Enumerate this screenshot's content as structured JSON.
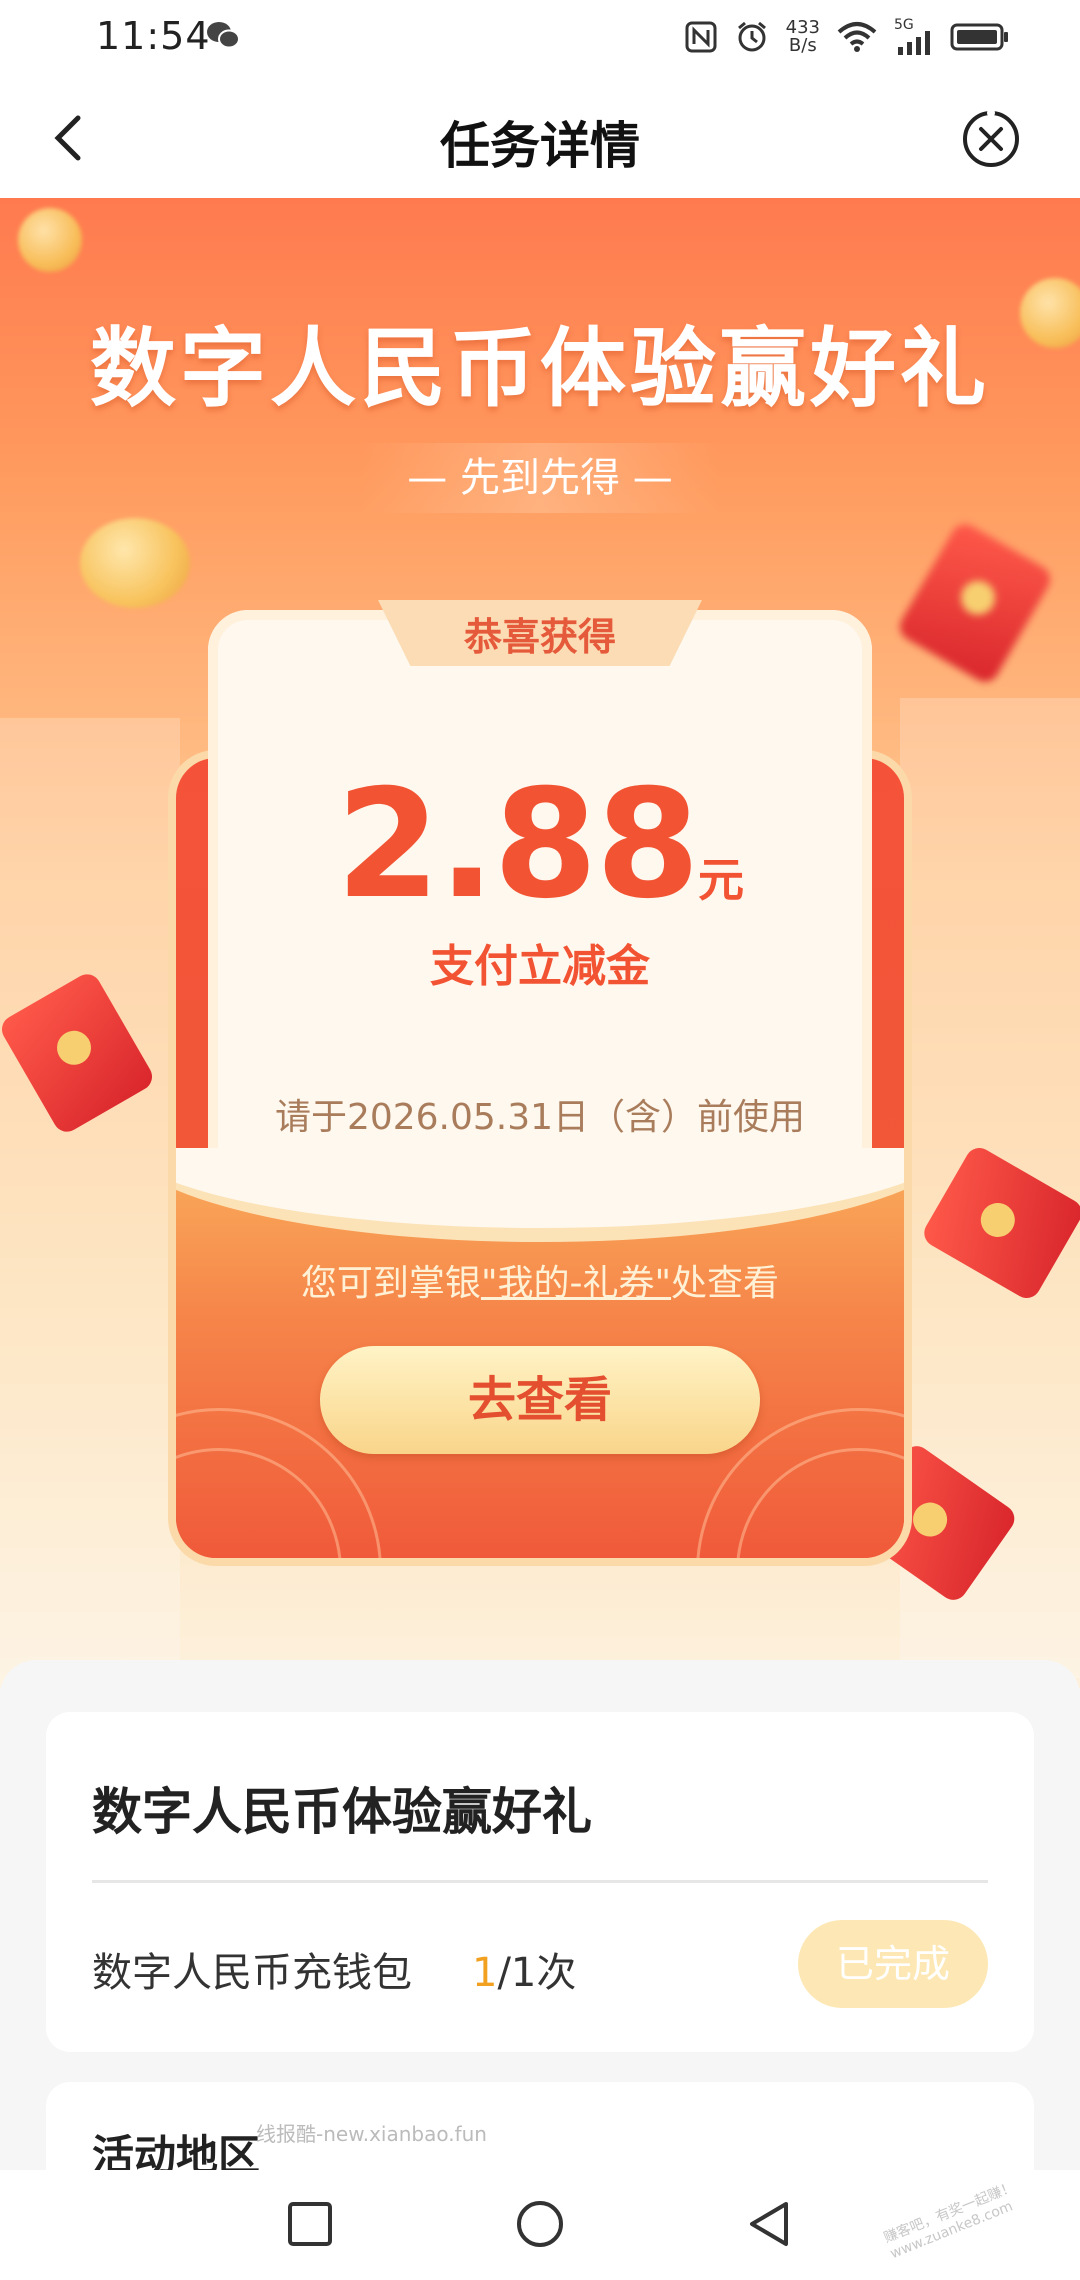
{
  "status_bar": {
    "time": "11:54",
    "net_speed_value": "433",
    "net_speed_unit": "B/s",
    "network_type": "5G",
    "icons": [
      "wechat-icon",
      "nfc-icon",
      "alarm-icon",
      "wifi-icon",
      "signal-icon",
      "battery-icon"
    ]
  },
  "nav": {
    "title": "任务详情",
    "back_icon": "chevron-left-icon",
    "close_icon": "close-circle-icon"
  },
  "hero": {
    "title": "数字人民币体验赢好礼",
    "subtitle": "— 先到先得 —",
    "ribbon": "恭喜获得",
    "amount": "2.88",
    "unit": "元",
    "amount_desc": "支付立减金",
    "expire": "请于2026.05.31日（含）前使用",
    "hint_prefix": "您可到掌银",
    "hint_link": "\"我的-礼券\"",
    "hint_suffix": "处查看",
    "button": "去查看"
  },
  "task": {
    "title": "数字人民币体验赢好礼",
    "items": [
      {
        "label": "数字人民币充钱包",
        "done": "1",
        "total": "/1次",
        "status": "已完成"
      }
    ]
  },
  "region": {
    "title": "活动地区"
  },
  "watermark": "线报酷-new.xianbao.fun",
  "watermark2": "赚客吧，有奖一起赚！ www.zuanke8.com",
  "colors": {
    "accent": "#f25433",
    "hero_top": "#ff7a4f",
    "done_bg": "#fde8b5",
    "count_highlight": "#f1a11f"
  }
}
